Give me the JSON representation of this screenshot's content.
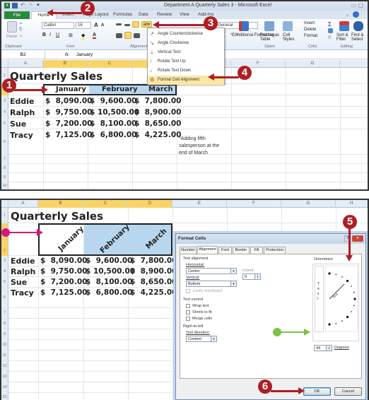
{
  "top_window": {
    "title": "Department A Quarterly Sales 3 - Microsoft Excel",
    "tabs": [
      "File",
      "Home",
      "Insert",
      "Page Layout",
      "Formulas",
      "Data",
      "Review",
      "View",
      "Add-Ins"
    ],
    "ribbon": {
      "clipboard": {
        "paste": "Paste",
        "label": "Clipboard"
      },
      "font": {
        "name": "Calibri",
        "size": "16",
        "label": "Font"
      },
      "alignment": {
        "label": "Alignment"
      },
      "number": {
        "format": "General",
        "label": "Number"
      },
      "styles": {
        "conditional": "Conditional Formatting",
        "format_table": "Format as Table",
        "cell_styles": "Cell Styles",
        "label": "Styles"
      },
      "cells": {
        "insert": "Insert",
        "delete": "Delete",
        "format": "Format",
        "label": "Cells"
      },
      "editing": {
        "autosum": "Σ",
        "sort": "Sort & Filter",
        "find": "Find & Select",
        "label": "Editing"
      }
    },
    "orientation_menu": [
      {
        "icon": "angle-counterclockwise-icon",
        "label": "Angle Counterclockwise"
      },
      {
        "icon": "angle-clockwise-icon",
        "label": "Angle Clockwise"
      },
      {
        "icon": "vertical-text-icon",
        "label": "Vertical Text"
      },
      {
        "icon": "rotate-up-icon",
        "label": "Rotate Text Up"
      },
      {
        "icon": "rotate-down-icon",
        "label": "Rotate Text Down"
      },
      {
        "icon": "format-alignment-icon",
        "label": "Format Cell Alignment"
      }
    ],
    "formula_bar": {
      "name_box": "B2",
      "fx": "fx",
      "value": "January"
    }
  },
  "sheet": {
    "columns": [
      "A",
      "B",
      "C",
      "D",
      "E",
      "F",
      "G",
      "H"
    ],
    "title": "Quarterly Sales",
    "months": [
      "January",
      "February",
      "March"
    ],
    "rows": [
      {
        "num": "3",
        "name": "Eddie",
        "values": [
          "$  8,090.00",
          "$  9,600.00",
          "$  7,800.00"
        ]
      },
      {
        "num": "4",
        "name": "Ralph",
        "values": [
          "$  9,750.00",
          "$ 10,500.00",
          "$  8,900.00"
        ]
      },
      {
        "num": "5",
        "name": "Sue",
        "values": [
          "$  7,200.00",
          "$  8,100.00",
          "$  8,650.00"
        ]
      },
      {
        "num": "6",
        "name": "Tracy",
        "values": [
          "$  7,125.00",
          "$  6,800.00",
          "$  4,225.00"
        ]
      }
    ],
    "note_lines": [
      "*Adding fifth",
      "salesperson at the",
      "end of March"
    ],
    "top_row_numbers": [
      "1",
      "2",
      "3",
      "4",
      "5",
      "6",
      "7",
      "8",
      "9",
      "10"
    ],
    "bottom_row_numbers": [
      "1",
      "2",
      "3",
      "4",
      "5",
      "6",
      "7",
      "8",
      "9",
      "10",
      "11",
      "12",
      "13",
      "14",
      "15"
    ]
  },
  "dialog": {
    "title": "Format Cells",
    "help": "?",
    "close": "x",
    "tabs": [
      "Number",
      "Alignment",
      "Font",
      "Border",
      "Fill",
      "Protection"
    ],
    "active_tab": "Alignment",
    "text_alignment": {
      "section": "Text alignment",
      "horizontal_label": "Horizontal:",
      "horizontal_value": "Center",
      "indent_label": "Indent:",
      "indent_value": "0",
      "vertical_label": "Vertical:",
      "vertical_value": "Bottom",
      "justify_distributed": "Justify distributed"
    },
    "text_control": {
      "section": "Text control",
      "wrap": "Wrap text",
      "shrink": "Shrink to fit",
      "merge": "Merge cells"
    },
    "rtl": {
      "section": "Right-to-left",
      "direction_label": "Text direction:",
      "direction_value": "Context"
    },
    "orientation": {
      "section": "Orientation",
      "vertical_text": "T e x t",
      "dial_text": "Text",
      "degrees_value": "44",
      "degrees_label": "Degrees"
    },
    "ok": "OK",
    "cancel": "Cancel"
  },
  "callouts": [
    "1",
    "2",
    "3",
    "4",
    "5",
    "6"
  ],
  "colors": {
    "callout_red": "#b01e23",
    "pink_arrow": "#d6167d",
    "green_arrow": "#7cc242",
    "header_blue": "#b8d7ef",
    "selected_header": "#f8d468"
  }
}
